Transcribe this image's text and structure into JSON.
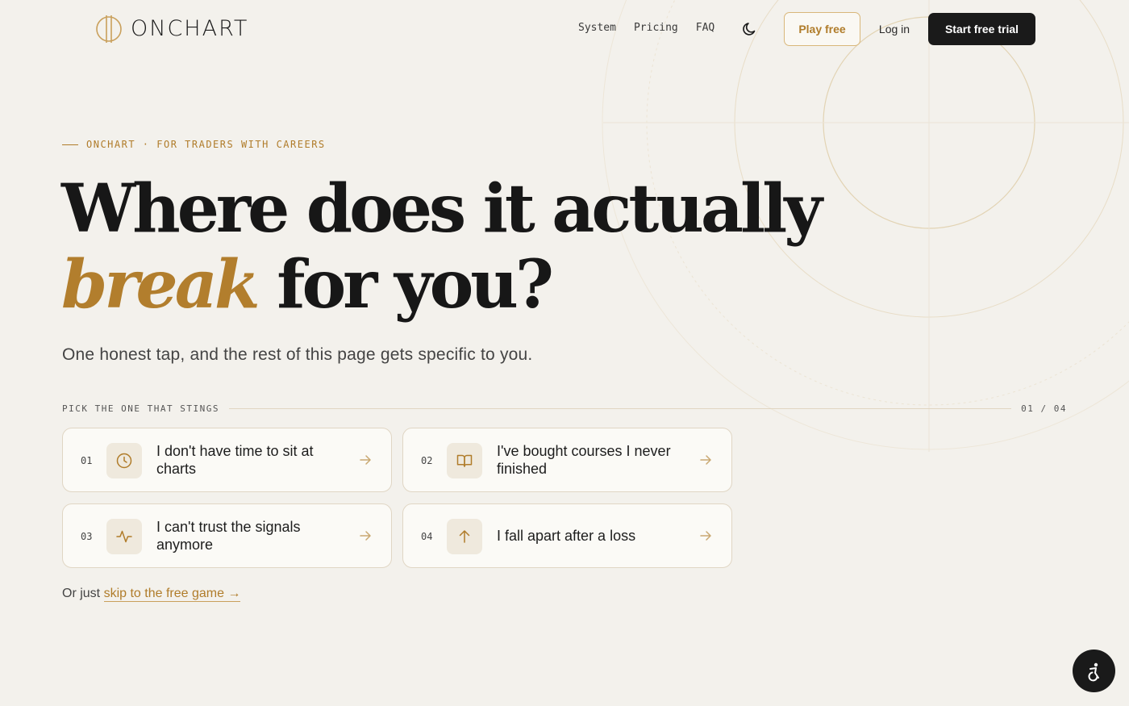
{
  "brand": {
    "name": "ONCHART"
  },
  "nav": {
    "items": [
      "System",
      "Pricing",
      "FAQ"
    ]
  },
  "header": {
    "theme_toggle_icon": "moon-icon",
    "play_free": "Play free",
    "login": "Log in",
    "start_trial": "Start free trial"
  },
  "hero": {
    "eyebrow": "ONCHART · FOR TRADERS WITH CAREERS",
    "headline_line1": "Where does it actually",
    "headline_accent": "break",
    "headline_rest": "for you?",
    "subhead": "One honest tap, and the rest of this page gets specific to you."
  },
  "picker": {
    "label": "PICK THE ONE THAT STINGS",
    "counter": "01 / 04",
    "options": [
      {
        "num": "01",
        "icon": "clock-icon",
        "text": "I don't have time to sit at charts"
      },
      {
        "num": "02",
        "icon": "book-icon",
        "text": "I've bought courses I never finished"
      },
      {
        "num": "03",
        "icon": "activity-icon",
        "text": "I can't trust the signals anymore"
      },
      {
        "num": "04",
        "icon": "arrow-up-icon",
        "text": "I fall apart after a loss"
      }
    ]
  },
  "skip": {
    "prefix": "Or just",
    "link": "skip to the free game →"
  },
  "accessibility": {
    "icon": "accessibility-icon"
  },
  "colors": {
    "background": "#f3f1ec",
    "accent": "#b07c2a",
    "dark": "#1a1a1a"
  }
}
